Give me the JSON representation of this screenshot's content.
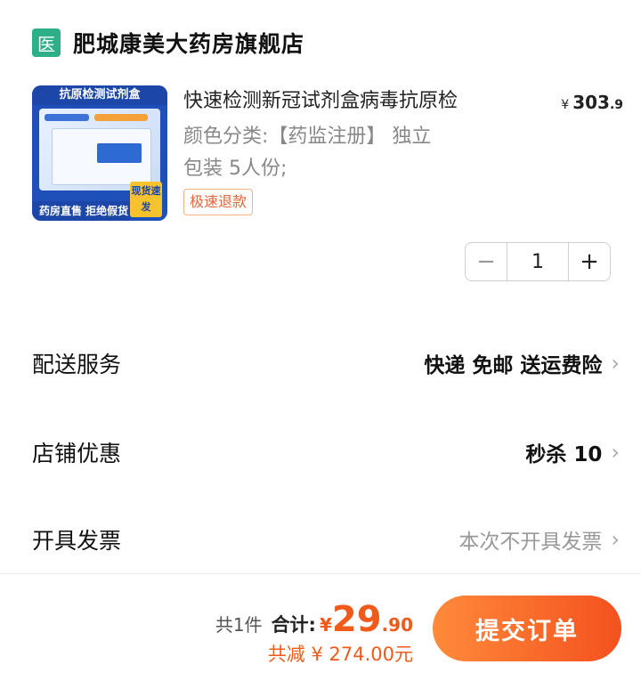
{
  "store": {
    "badge": "医",
    "name": "肥城康美大药房旗舰店"
  },
  "product": {
    "image": {
      "title": "抗原检测试剂盒",
      "bottom_text": "药房直售 拒绝假货",
      "corner_tag": "现货速发"
    },
    "title": "快速检测新冠试剂盒病毒抗原检",
    "price": {
      "currency": "¥",
      "integer": "303",
      "decimal": ".9"
    },
    "variant_line1": "颜色分类:【药监注册】 独立",
    "variant_line2": "包装 5人份;",
    "refund_tag": "极速退款",
    "quantity": {
      "minus": "−",
      "value": "1",
      "plus": "+"
    }
  },
  "rows": [
    {
      "label": "配送服务",
      "value": "快递 免邮 送运费险"
    },
    {
      "label": "店铺优惠",
      "value": "秒杀 10"
    },
    {
      "label": "开具发票",
      "value": "本次不开具发票"
    }
  ],
  "footer": {
    "count": "共1件",
    "total_label": "合计:",
    "currency": "¥",
    "total_int": "29",
    "total_dec": ".90",
    "saved": "共减 ¥ 274.00元",
    "submit": "提交订单"
  },
  "colors": {
    "accent": "#f05a1a",
    "badge": "#2db08a",
    "refund_tag": "#e4663a"
  }
}
